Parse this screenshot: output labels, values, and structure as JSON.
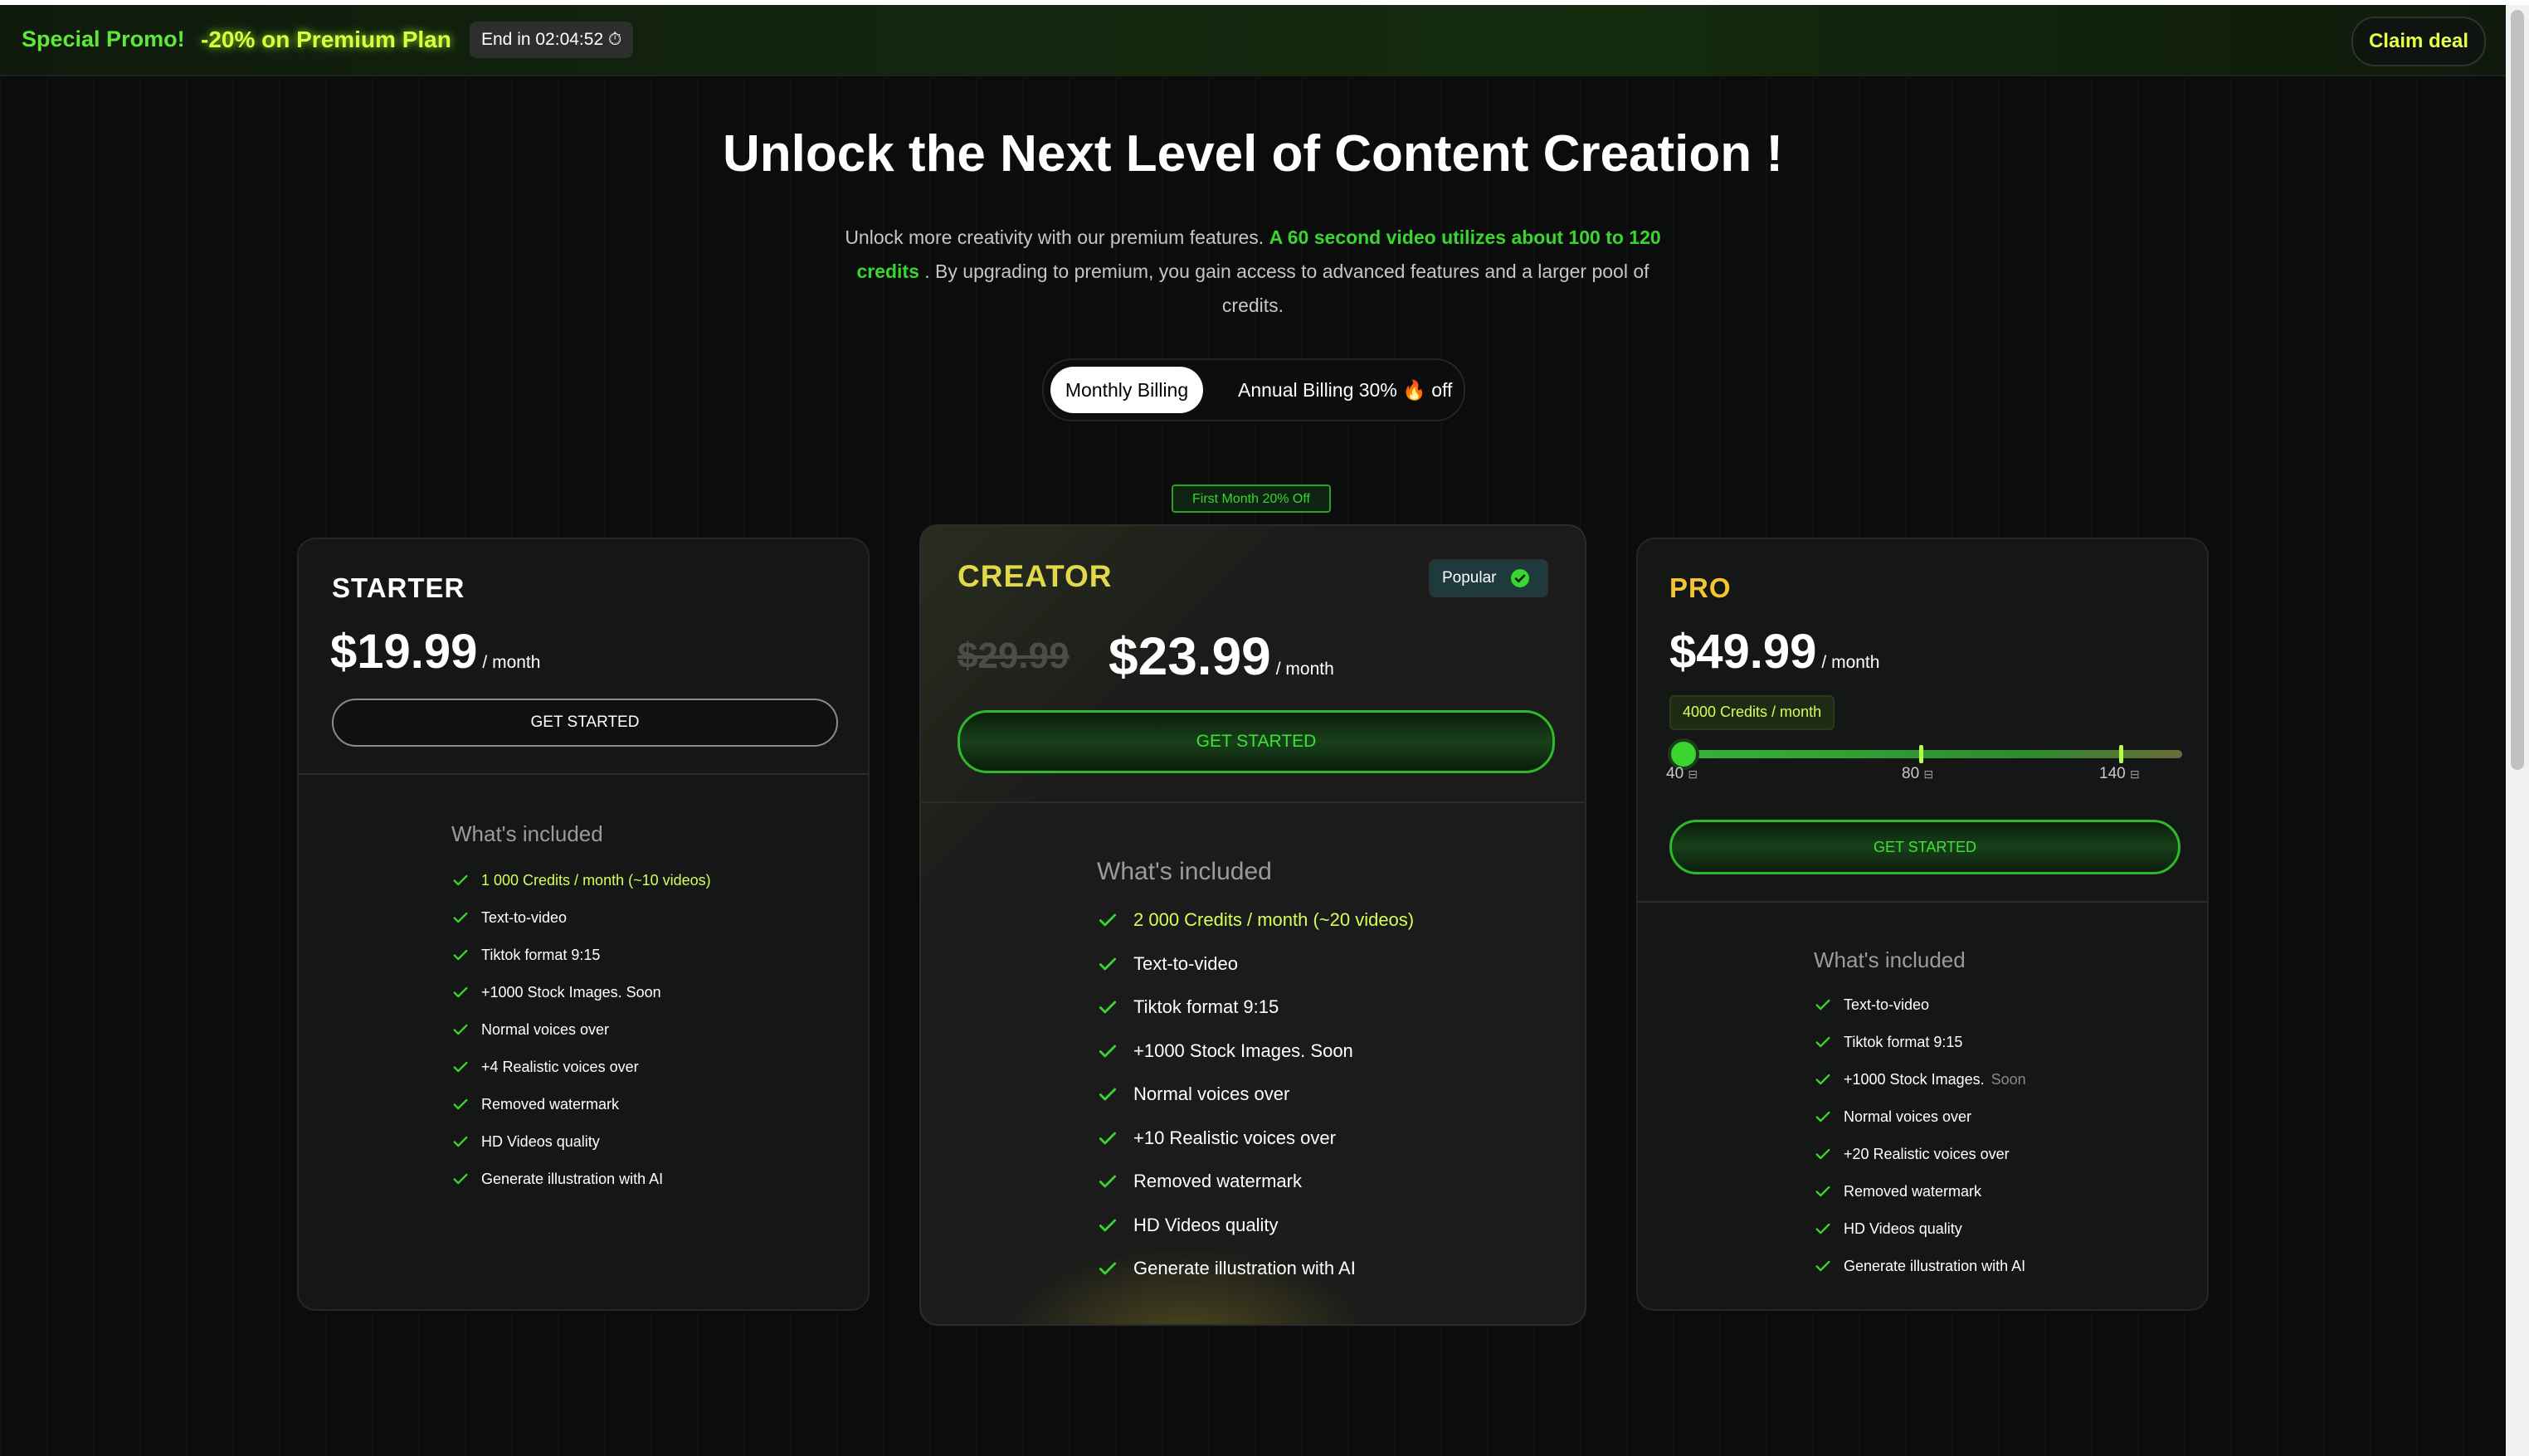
{
  "promo": {
    "label": "Special Promo!",
    "offer": "-20% on Premium Plan",
    "timer": "End in 02:04:52 ⏱",
    "claim_label": "Claim deal"
  },
  "hero": {
    "title": "Unlock the Next Level of Content Creation !",
    "sub_pre": "Unlock more creativity with our premium features.",
    "sub_highlight": "A 60 second video utilizes about 100 to 120 credits",
    "sub_post": ". By upgrading to premium, you gain access to advanced features and a larger pool of credits."
  },
  "billing": {
    "monthly": "Monthly Billing",
    "annual": "Annual Billing 30% 🔥 off"
  },
  "plans": {
    "starter": {
      "title": "STARTER",
      "price": "$19.99",
      "period": "/ month",
      "cta": "GET STARTED",
      "included_label": "What's included",
      "features": [
        "1 000 Credits / month (~10 videos)",
        "Text-to-video",
        "Tiktok format 9:15",
        "+1000 Stock Images. Soon",
        "Normal voices over",
        "+4 Realistic voices over",
        "Removed watermark",
        "HD Videos quality",
        "Generate illustration with AI"
      ]
    },
    "creator": {
      "ribbon": "First Month 20% Off",
      "title": "CREATOR",
      "badge": "Popular",
      "old_price": "$29.99",
      "price": "$23.99",
      "period": "/ month",
      "cta": "GET STARTED",
      "included_label": "What's included",
      "features": [
        "2 000 Credits / month (~20 videos)",
        "Text-to-video",
        "Tiktok format 9:15",
        "+1000 Stock Images. Soon",
        "Normal voices over",
        "+10 Realistic voices over",
        "Removed watermark",
        "HD Videos quality",
        "Generate illustration with AI"
      ]
    },
    "pro": {
      "title": "PRO",
      "price": "$49.99",
      "period": "/ month",
      "credits": "4000 Credits / month",
      "slider_labels": [
        "40",
        "80",
        "140"
      ],
      "slider_value": 40,
      "cta": "GET STARTED",
      "included_label": "What's included",
      "features": [
        "Text-to-video",
        "Tiktok format 9:15",
        "+1000 Stock Images.",
        "Normal voices over",
        "+20 Realistic voices over",
        "Removed watermark",
        "HD Videos quality",
        "Generate illustration with AI"
      ],
      "soon_label": "Soon"
    }
  },
  "colors": {
    "accent_green": "#3ad52f",
    "accent_yellow": "#e6ff48",
    "creator_title": "#e1d94a",
    "pro_title": "#f3c530"
  }
}
